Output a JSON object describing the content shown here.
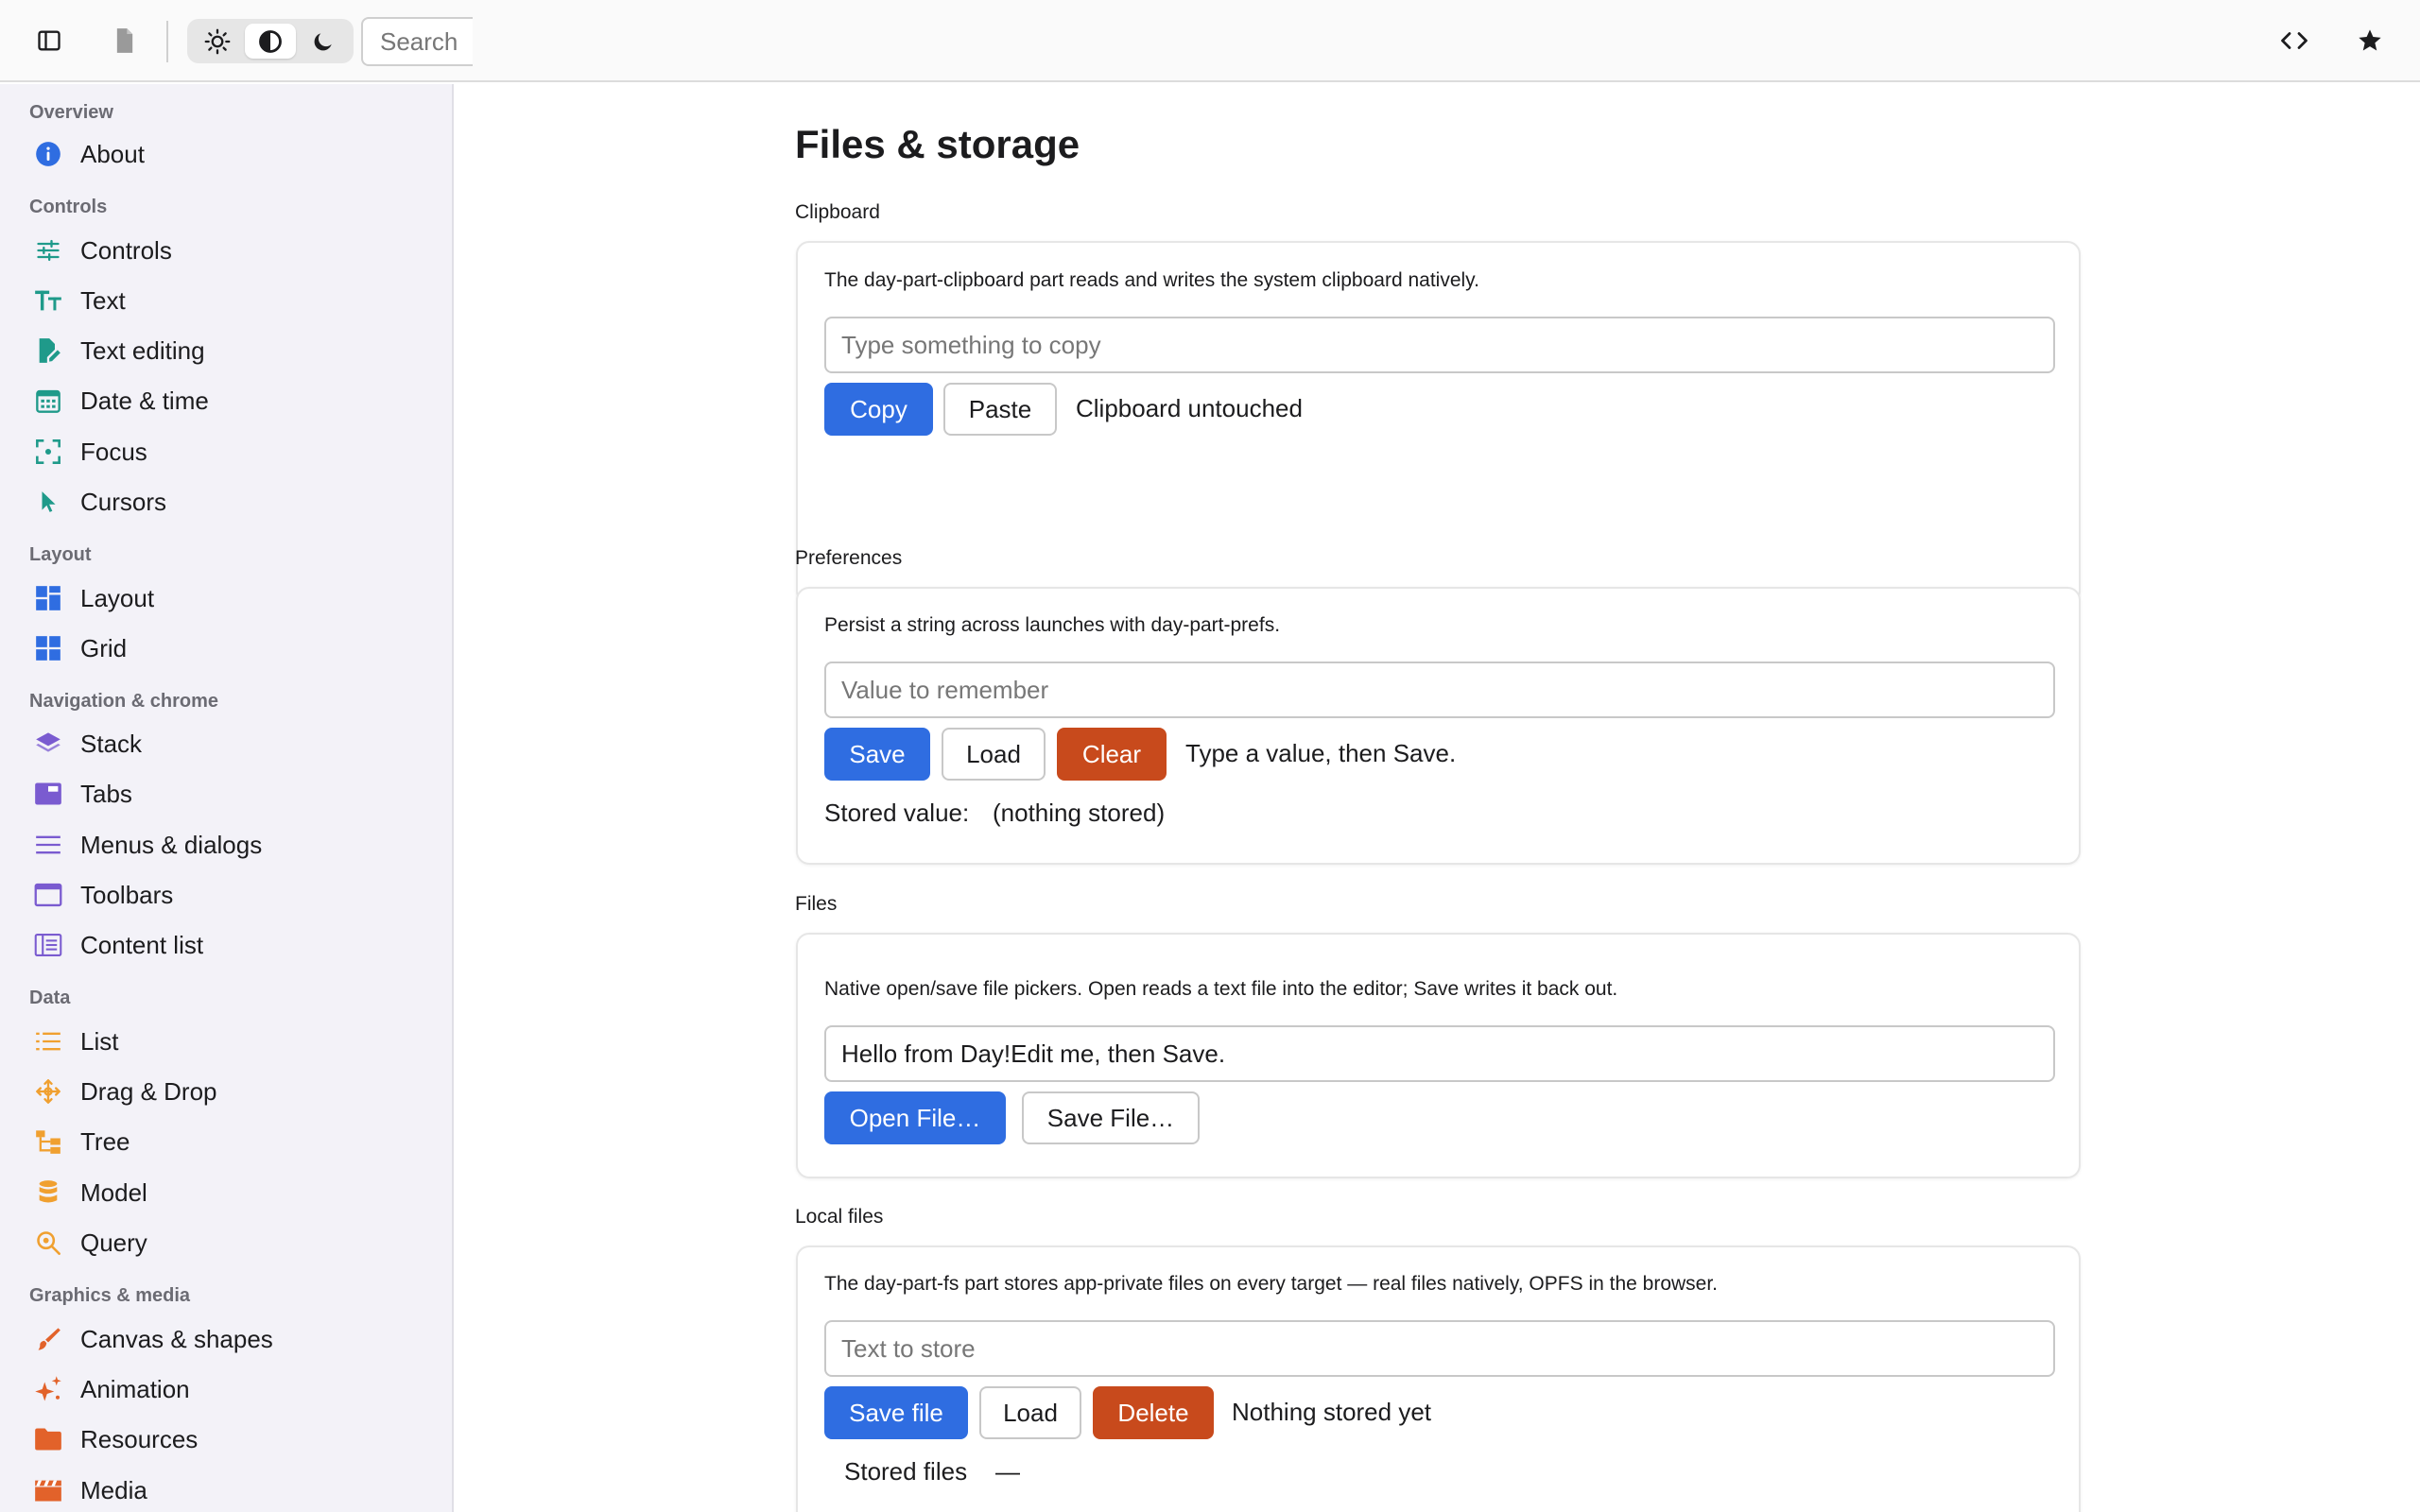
{
  "toolbar": {
    "search_placeholder": "Search",
    "icons": [
      "sidebar-toggle-icon",
      "document-icon",
      "sun-icon",
      "contrast-icon",
      "moon-icon",
      "code-icon",
      "star-icon"
    ],
    "active_theme": "contrast"
  },
  "sidebar": {
    "sections": [
      {
        "title": "Overview",
        "items": [
          {
            "label": "About",
            "icon": "info-icon"
          }
        ]
      },
      {
        "title": "Controls",
        "items": [
          {
            "label": "Controls",
            "icon": "sliders-icon"
          },
          {
            "label": "Text",
            "icon": "text-icon"
          },
          {
            "label": "Text editing",
            "icon": "edit-document-icon"
          },
          {
            "label": "Date & time",
            "icon": "calendar-icon"
          },
          {
            "label": "Focus",
            "icon": "focus-icon"
          },
          {
            "label": "Cursors",
            "icon": "cursor-icon"
          }
        ]
      },
      {
        "title": "Layout",
        "items": [
          {
            "label": "Layout",
            "icon": "layout-icon"
          },
          {
            "label": "Grid",
            "icon": "grid-icon"
          }
        ]
      },
      {
        "title": "Navigation & chrome",
        "items": [
          {
            "label": "Stack",
            "icon": "layers-icon"
          },
          {
            "label": "Tabs",
            "icon": "tabs-icon"
          },
          {
            "label": "Menus & dialogs",
            "icon": "menu-icon"
          },
          {
            "label": "Toolbars",
            "icon": "window-icon"
          },
          {
            "label": "Content list",
            "icon": "content-list-icon"
          }
        ]
      },
      {
        "title": "Data",
        "items": [
          {
            "label": "List",
            "icon": "list-icon"
          },
          {
            "label": "Drag & Drop",
            "icon": "move-icon"
          },
          {
            "label": "Tree",
            "icon": "tree-icon"
          },
          {
            "label": "Model",
            "icon": "database-icon"
          },
          {
            "label": "Query",
            "icon": "search-icon"
          }
        ]
      },
      {
        "title": "Graphics & media",
        "items": [
          {
            "label": "Canvas & shapes",
            "icon": "brush-icon"
          },
          {
            "label": "Animation",
            "icon": "sparkle-icon"
          },
          {
            "label": "Resources",
            "icon": "folder-icon"
          },
          {
            "label": "Media",
            "icon": "clapperboard-icon"
          }
        ]
      }
    ]
  },
  "main": {
    "title": "Files & storage",
    "clipboard": {
      "title": "Clipboard",
      "desc": "The day-part-clipboard part reads and writes the system clipboard natively.",
      "placeholder": "Type something to copy",
      "copy": "Copy",
      "paste": "Paste",
      "status": "Clipboard untouched"
    },
    "prefs": {
      "title": "Preferences",
      "desc": "Persist a string across launches with day-part-prefs.",
      "placeholder": "Value to remember",
      "save": "Save",
      "load": "Load",
      "clear": "Clear",
      "status": "Type a value, then Save.",
      "stored_label": "Stored value:",
      "stored_value": "(nothing stored)"
    },
    "files": {
      "title": "Files",
      "desc": "Native open/save file pickers. Open reads a text file into the editor; Save writes it back out.",
      "value": "Hello from Day!Edit me, then Save.",
      "open": "Open File…",
      "save": "Save File…"
    },
    "local": {
      "title": "Local files",
      "desc": "The day-part-fs part stores app-private files on every target — real files natively, OPFS in the browser.",
      "placeholder": "Text to store",
      "save": "Save file",
      "load": "Load",
      "delete": "Delete",
      "status": "Nothing stored yet",
      "stored_label": "Stored files",
      "stored_value": "—"
    }
  },
  "colors": {
    "accent": "#2f6de1",
    "danger": "#c84a1c",
    "overview": "#2f6de1",
    "controls": "#1f9a8a",
    "layout": "#2f6de1",
    "navigation": "#7a5bd0",
    "data": "#f0a030",
    "graphics": "#e2622a"
  }
}
